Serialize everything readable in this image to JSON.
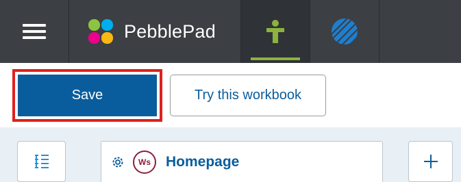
{
  "topbar": {
    "menu_icon": "hamburger-icon",
    "brand": {
      "logo_icon": "pebblepad-logo",
      "name": "PebblePad",
      "logo_colors": [
        "#8bc53f",
        "#00aeef",
        "#ec008c",
        "#fdb913"
      ]
    },
    "tabs": [
      {
        "icon": "person-icon",
        "active": true,
        "color": "#8bb33e"
      },
      {
        "icon": "globe-icon",
        "active": false,
        "color": "#1e7fd0"
      }
    ],
    "background": "#3c3f44"
  },
  "toolbar": {
    "save_label": "Save",
    "try_label": "Try this workbook",
    "save_color": "#0a5d9c",
    "highlight_color": "#e0201c"
  },
  "pages": {
    "contents_icon": "list-icon",
    "current": {
      "settings_icon": "gear-icon",
      "badge": "Ws",
      "title": "Homepage"
    },
    "add_icon": "plus-icon"
  }
}
